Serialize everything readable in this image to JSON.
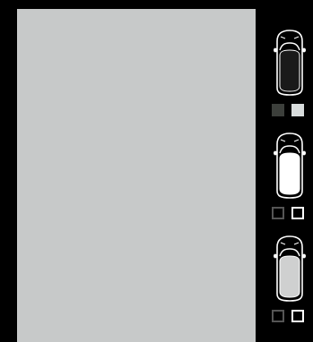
{
  "preview": {
    "background": "#c7c9c9"
  },
  "car_options": [
    {
      "icon": "car-top-view-icon",
      "body_color": "#1a1a1a",
      "selected": true,
      "swatches": [
        {
          "color": "#3c3f3b",
          "border": "#3c3f3b"
        },
        {
          "color": "#d8dcdc",
          "border": "#d8dcdc"
        }
      ]
    },
    {
      "icon": "car-top-view-icon",
      "body_color": "#ffffff",
      "selected": false,
      "swatches": [
        {
          "color": "#000000",
          "border": "#555555"
        },
        {
          "color": "#000000",
          "border": "#ffffff"
        }
      ]
    },
    {
      "icon": "car-top-view-icon",
      "body_color": "#cfd0d0",
      "selected": false,
      "swatches": [
        {
          "color": "#000000",
          "border": "#555555"
        },
        {
          "color": "#000000",
          "border": "#ffffff"
        }
      ]
    }
  ]
}
